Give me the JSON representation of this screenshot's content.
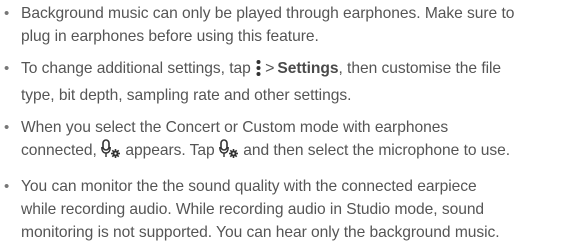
{
  "notes": [
    {
      "lines": [
        "Background music can only be played through earphones. Make sure to",
        "plug in earphones before using this feature."
      ]
    },
    {
      "line1_prefix": "To change additional settings, tap ",
      "chevron": ">",
      "settings_label": "Settings",
      "line1_suffix": ", then customise the file",
      "line2": "type, bit depth, sampling rate and other settings."
    },
    {
      "line1": "When you select the Concert or Custom mode with earphones",
      "line2_prefix": "connected, ",
      "line2_middle": " appears. Tap ",
      "line2_suffix": " and then select the microphone to use."
    },
    {
      "lines": [
        "You can monitor the the sound quality with the connected earpiece",
        "while recording audio. While recording audio in Studio mode, sound",
        "monitoring is not supported. You can hear only the background music."
      ]
    }
  ],
  "bullet_char": "•",
  "icons": {
    "more": "more-options-icon",
    "mic_settings": "microphone-settings-icon"
  },
  "colors": {
    "text": "#555555",
    "bold_text": "#4a4a4a"
  }
}
